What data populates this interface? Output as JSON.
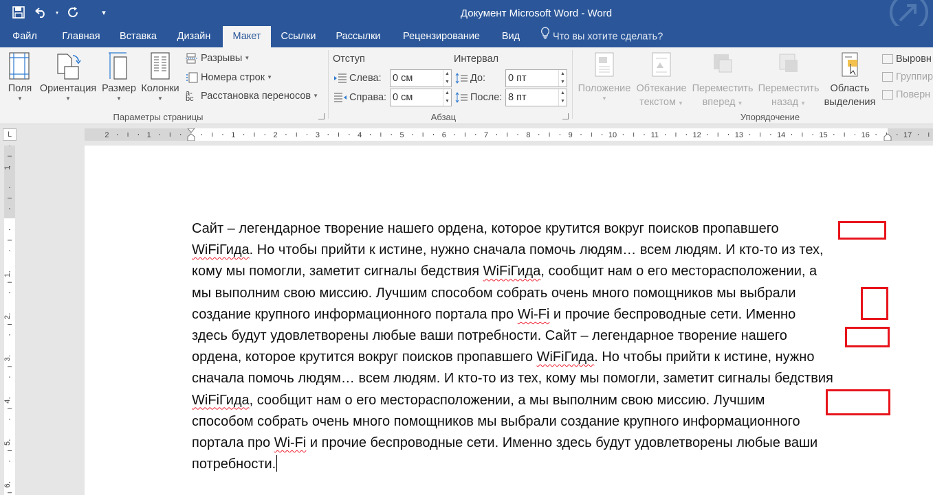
{
  "window": {
    "title": "Документ Microsoft Word - Word"
  },
  "qat": {
    "save_icon": "save-icon",
    "undo_icon": "undo-icon",
    "redo_icon": "redo-icon",
    "customize_icon": "customize-qat-icon"
  },
  "tabs": [
    {
      "label": "Файл"
    },
    {
      "label": "Главная"
    },
    {
      "label": "Вставка"
    },
    {
      "label": "Дизайн"
    },
    {
      "label": "Макет",
      "active": true
    },
    {
      "label": "Ссылки"
    },
    {
      "label": "Рассылки"
    },
    {
      "label": "Рецензирование"
    },
    {
      "label": "Вид"
    }
  ],
  "tell_me": "Что вы хотите сделать?",
  "ribbon": {
    "page_setup": {
      "margins": "Поля",
      "orientation": "Ориентация",
      "size": "Размер",
      "columns": "Колонки",
      "breaks": "Разрывы",
      "line_numbers": "Номера строк",
      "hyphenation": "Расстановка переносов",
      "group_label": "Параметры страницы"
    },
    "paragraph": {
      "indent_header": "Отступ",
      "spacing_header": "Интервал",
      "left_label": "Слева:",
      "left_value": "0 см",
      "right_label": "Справа:",
      "right_value": "0 см",
      "before_label": "До:",
      "before_value": "0 пт",
      "after_label": "После:",
      "after_value": "8 пт",
      "group_label": "Абзац"
    },
    "arrange": {
      "position": "Положение",
      "wrap_text_1": "Обтекание",
      "wrap_text_2": "текстом",
      "bring_forward_1": "Переместить",
      "bring_forward_2": "вперед",
      "send_backward_1": "Переместить",
      "send_backward_2": "назад",
      "selection_pane_1": "Область",
      "selection_pane_2": "выделения",
      "align": "Выровн",
      "group": "Группир",
      "rotate": "Поверн",
      "group_label": "Упорядочение"
    }
  },
  "ruler": {
    "corner": "L",
    "h_labels_left": [
      "2",
      "1"
    ],
    "h_labels_right": [
      "1",
      "2",
      "3",
      "4",
      "5",
      "6",
      "7",
      "8",
      "9",
      "10",
      "11",
      "12",
      "13",
      "14",
      "15",
      "16",
      "17"
    ],
    "v_labels": [
      "1",
      "1",
      "2",
      "3",
      "4",
      "5",
      "6"
    ]
  },
  "document": {
    "lines": [
      [
        {
          "t": "Сайт – легендарное творение нашего ордена, которое крутится вокруг поисков пропавшего"
        }
      ],
      [
        {
          "t": "WiFiГида",
          "sq": true
        },
        {
          "t": ". Но чтобы прийти к истине, нужно сначала помочь людям… всем людям. И кто-то из тех,"
        }
      ],
      [
        {
          "t": "кому мы помогли, заметит сигналы бедствия "
        },
        {
          "t": "WiFiГида",
          "sq": true
        },
        {
          "t": ", сообщит нам о его месторасположении, а"
        }
      ],
      [
        {
          "t": "мы выполним свою миссию. Лучшим способом собрать очень много помощников мы выбрали"
        }
      ],
      [
        {
          "t": "создание крупного информационного портала про "
        },
        {
          "t": "Wi-Fi",
          "sq": true
        },
        {
          "t": " и прочие беспроводные сети. Именно"
        }
      ],
      [
        {
          "t": "здесь будут удовлетворены любые ваши потребности. Сайт – легендарное творение нашего"
        }
      ],
      [
        {
          "t": "ордена, которое крутится вокруг поисков пропавшего "
        },
        {
          "t": "WiFiГида",
          "sq": true
        },
        {
          "t": ". Но чтобы прийти к истине, нужно"
        }
      ],
      [
        {
          "t": "сначала помочь людям… всем людям. И кто-то из тех, кому мы помогли, заметит сигналы бедствия"
        }
      ],
      [
        {
          "t": "WiFiГида",
          "sq": true
        },
        {
          "t": ", сообщит нам о его месторасположении, а мы выполним свою миссию. Лучшим"
        }
      ],
      [
        {
          "t": "способом собрать очень много помощников мы выбрали создание крупного информационного"
        }
      ],
      [
        {
          "t": "портала про "
        },
        {
          "t": "Wi-Fi",
          "sq": true
        },
        {
          "t": " и прочие беспроводные сети. Именно здесь будут удовлетворены любые ваши"
        }
      ],
      [
        {
          "t": "потребности."
        }
      ]
    ],
    "annotation_color": "#e8141b"
  },
  "colors": {
    "accent": "#2b579a",
    "ribbon_bg": "#f3f3f3",
    "annotation": "#e8141b"
  }
}
